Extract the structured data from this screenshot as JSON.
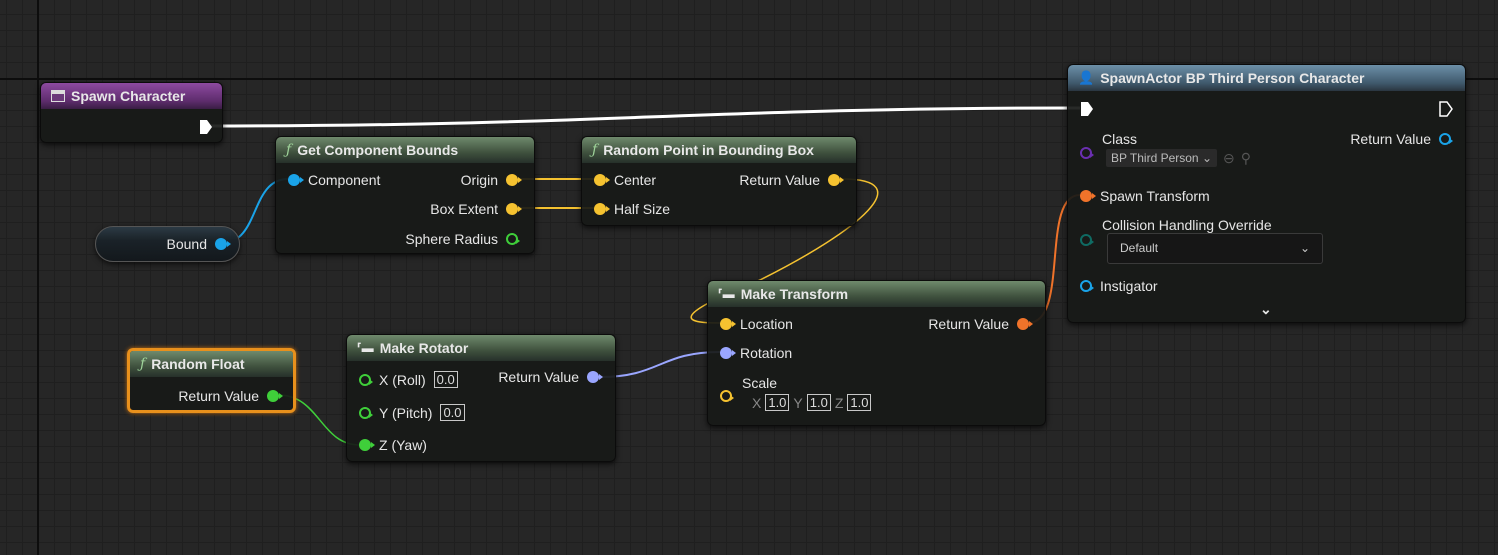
{
  "colors": {
    "exec": "#ffffff",
    "object": "#1aa3e8",
    "vector": "#f5c230",
    "float": "#3fcf3a",
    "rotator": "#9aa6ff",
    "transform": "#f0732a",
    "class": "#6a2fb0",
    "byte": "#0f6b63"
  },
  "spawn_character": {
    "title": "Spawn Character"
  },
  "bound": {
    "label": "Bound"
  },
  "get_bounds": {
    "title": "Get Component Bounds",
    "icon": "function-icon",
    "component": "Component",
    "origin": "Origin",
    "box_extent": "Box Extent",
    "sphere_radius": "Sphere Radius"
  },
  "random_point": {
    "title": "Random Point in Bounding Box",
    "icon": "function-icon",
    "center": "Center",
    "half_size": "Half Size",
    "return_value": "Return Value"
  },
  "random_float": {
    "title": "Random Float",
    "return_value": "Return Value"
  },
  "make_rotator": {
    "title": "Make Rotator",
    "x": "X (Roll)",
    "x_val": "0.0",
    "y": "Y (Pitch)",
    "y_val": "0.0",
    "z": "Z (Yaw)",
    "return_value": "Return Value"
  },
  "make_transform": {
    "title": "Make Transform",
    "location": "Location",
    "rotation": "Rotation",
    "scale": "Scale",
    "sx_lbl": "X",
    "sx": "1.0",
    "sy_lbl": "Y",
    "sy": "1.0",
    "sz_lbl": "Z",
    "sz": "1.0",
    "return_value": "Return Value"
  },
  "spawn_actor": {
    "title": "SpawnActor BP Third Person Character",
    "class": "Class",
    "class_value": "BP Third Person",
    "return_value": "Return Value",
    "spawn_transform": "Spawn Transform",
    "collision": "Collision Handling Override",
    "collision_value": "Default",
    "instigator": "Instigator"
  }
}
